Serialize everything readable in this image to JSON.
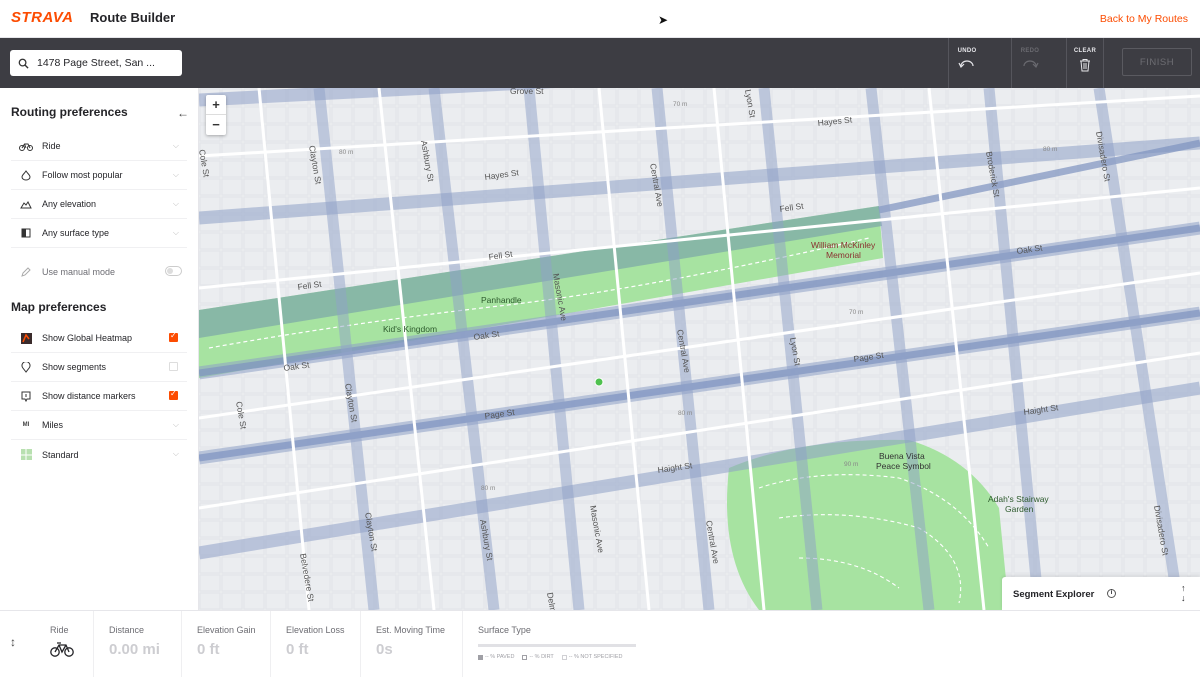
{
  "header": {
    "logo": "STRAVA",
    "title": "Route Builder",
    "back_link": "Back to My Routes"
  },
  "toolbar": {
    "search_value": "1478 Page Street, San ...",
    "undo_label": "UNDO",
    "redo_label": "REDO",
    "clear_label": "CLEAR",
    "finish_label": "FINISH"
  },
  "sidebar": {
    "routing_title": "Routing preferences",
    "routing_items": [
      {
        "label": "Ride",
        "icon": "bike-icon"
      },
      {
        "label": "Follow most popular",
        "icon": "popular-icon"
      },
      {
        "label": "Any elevation",
        "icon": "elevation-icon"
      },
      {
        "label": "Any surface type",
        "icon": "surface-icon"
      }
    ],
    "manual_mode": "Use manual mode",
    "map_title": "Map preferences",
    "map_items": [
      {
        "label": "Show Global Heatmap",
        "checked": true
      },
      {
        "label": "Show segments",
        "checked": false
      },
      {
        "label": "Show distance markers",
        "checked": true
      },
      {
        "label": "Miles",
        "icon_text": "MI"
      },
      {
        "label": "Standard"
      }
    ]
  },
  "map": {
    "streets": {
      "grove": "Grove St",
      "hayes_top": "Hayes St",
      "hayes_mid": "Hayes St",
      "fell_left": "Fell St",
      "fell_mid": "Fell St",
      "fell_right": "Fell St",
      "oak_left": "Oak St",
      "oak_mid": "Oak St",
      "oak_right": "Oak St",
      "page_mid": "Page St",
      "page_right": "Page St",
      "haight_mid": "Haight St",
      "haight_right": "Haight St",
      "clayton_top": "Clayton St",
      "clayton_mid": "Clayton St",
      "clayton_bot": "Clayton St",
      "ashbury_top": "Ashbury St",
      "ashbury_bot": "Ashbury St",
      "masonic_top": "Masonic Ave",
      "masonic_bot": "Masonic Ave",
      "central_top": "Central Ave",
      "central_mid": "Central Ave",
      "central_bot": "Central Ave",
      "lyon_top": "Lyon St",
      "lyon_mid": "Lyon St",
      "broderick": "Broderick St",
      "divisadero_top": "Divisadero St",
      "divisadero_bot": "Divisadero St",
      "cole": "Cole St",
      "belvedere": "Belvedere St",
      "cole_left": "Cole St",
      "delmar": "Delm"
    },
    "places": {
      "mckinley": "William McKinley",
      "mckinley2": "Memorial",
      "panhandle": "Panhandle",
      "kids_kingdom": "Kid's Kingdom",
      "buena_vista": "Buena Vista",
      "buena_vista2": "Peace Symbol",
      "adah": "Adah's Stairway",
      "adah2": "Garden"
    },
    "elevation_marks": [
      "70 m",
      "80 m",
      "70 m",
      "80 m",
      "80 m",
      "90 m",
      "80 m"
    ],
    "zoom_in": "+",
    "zoom_out": "−"
  },
  "segment_explorer": {
    "label": "Segment Explorer",
    "info": "i"
  },
  "stats": {
    "ride_label": "Ride",
    "distance_label": "Distance",
    "distance_value": "0.00 mi",
    "gain_label": "Elevation Gain",
    "gain_value": "0 ft",
    "loss_label": "Elevation Loss",
    "loss_value": "0 ft",
    "time_label": "Est. Moving Time",
    "time_value": "0s",
    "surface_label": "Surface Type",
    "surface_paved": "-- % PAVED",
    "surface_dirt": "-- % DIRT",
    "surface_unspecified": "-- % NOT SPECIFIED"
  },
  "colors": {
    "brand": "#fc4c02",
    "toolbar": "#3d3d43",
    "park": "#a7e3a1",
    "heat": "#7e93c0"
  }
}
